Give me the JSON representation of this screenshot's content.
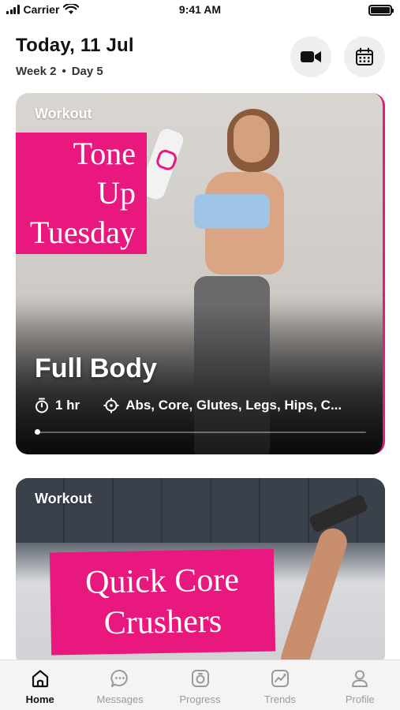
{
  "status_bar": {
    "carrier": "Carrier",
    "time": "9:41 AM"
  },
  "header": {
    "date": "Today, 11 Jul",
    "week": "Week 2",
    "day": "Day 5",
    "separator": "•"
  },
  "cards": [
    {
      "kicker": "Workout",
      "banner_lines": [
        "Tone",
        "Up",
        "Tuesday"
      ],
      "title": "Full Body",
      "duration": "1 hr",
      "focus": "Abs, Core, Glutes, Legs, Hips, C...",
      "progress_fraction": 0.0
    },
    {
      "kicker": "Workout",
      "banner_lines": [
        "Quick Core",
        "Crushers"
      ]
    }
  ],
  "tabs": [
    {
      "label": "Home",
      "icon": "home-icon",
      "active": true
    },
    {
      "label": "Messages",
      "icon": "messages-icon",
      "active": false
    },
    {
      "label": "Progress",
      "icon": "progress-icon",
      "active": false
    },
    {
      "label": "Trends",
      "icon": "trends-icon",
      "active": false
    },
    {
      "label": "Profile",
      "icon": "profile-icon",
      "active": false
    }
  ],
  "colors": {
    "accent_pink": "#e8187e",
    "tab_inactive": "#9a9a9a",
    "tab_active": "#111111"
  }
}
